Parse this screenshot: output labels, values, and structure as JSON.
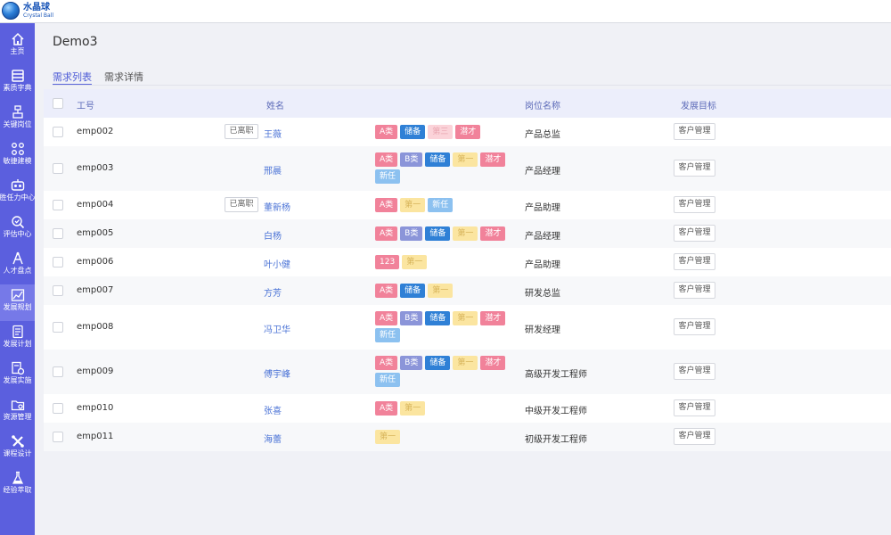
{
  "app": {
    "logo_cn": "水晶球",
    "logo_en": "Crystal Ball"
  },
  "sidebar": {
    "items": [
      {
        "label": "主页",
        "icon": "home-icon"
      },
      {
        "label": "素质字典",
        "icon": "dictionary-icon"
      },
      {
        "label": "关键岗位",
        "icon": "key-position-icon"
      },
      {
        "label": "敏捷建模",
        "icon": "modeling-icon"
      },
      {
        "label": "胜任力中心",
        "icon": "competency-icon"
      },
      {
        "label": "评估中心",
        "icon": "assessment-icon"
      },
      {
        "label": "人才盘点",
        "icon": "talent-review-icon"
      },
      {
        "label": "发展规划",
        "icon": "development-plan-icon",
        "active": true
      },
      {
        "label": "发展计划",
        "icon": "development-schedule-icon"
      },
      {
        "label": "发展实施",
        "icon": "development-implement-icon"
      },
      {
        "label": "资源管理",
        "icon": "resource-folder-icon"
      },
      {
        "label": "课程设计",
        "icon": "course-design-icon"
      },
      {
        "label": "经验萃取",
        "icon": "experience-flask-icon"
      }
    ]
  },
  "page": {
    "title": "Demo3"
  },
  "tabs": [
    {
      "label": "需求列表",
      "active": true
    },
    {
      "label": "需求详情",
      "active": false
    }
  ],
  "table": {
    "headers": {
      "id": "工号",
      "name": "姓名",
      "position": "岗位名称",
      "goal": "发展目标"
    },
    "rows": [
      {
        "id": "emp002",
        "name": "王薇",
        "status": "已离职",
        "tags": [
          {
            "text": "A类",
            "cls": "t-a"
          },
          {
            "text": "储备",
            "cls": "t-cb"
          },
          {
            "text": "第三",
            "cls": "t-d3"
          },
          {
            "text": "潜才",
            "cls": "t-qc"
          }
        ],
        "position": "产品总监",
        "goal": "客户管理"
      },
      {
        "id": "emp003",
        "name": "邢晨",
        "status": "",
        "tags": [
          {
            "text": "A类",
            "cls": "t-a"
          },
          {
            "text": "B类",
            "cls": "t-b"
          },
          {
            "text": "储备",
            "cls": "t-cb"
          },
          {
            "text": "第一",
            "cls": "t-d1"
          },
          {
            "text": "潜才",
            "cls": "t-qc"
          },
          {
            "text": "新任",
            "cls": "t-new"
          }
        ],
        "position": "产品经理",
        "goal": "客户管理"
      },
      {
        "id": "emp004",
        "name": "董新杨",
        "status": "已离职",
        "tags": [
          {
            "text": "A类",
            "cls": "t-a"
          },
          {
            "text": "第一",
            "cls": "t-d1"
          },
          {
            "text": "新任",
            "cls": "t-new"
          }
        ],
        "position": "产品助理",
        "goal": "客户管理"
      },
      {
        "id": "emp005",
        "name": "白杨",
        "status": "",
        "tags": [
          {
            "text": "A类",
            "cls": "t-a"
          },
          {
            "text": "B类",
            "cls": "t-b"
          },
          {
            "text": "储备",
            "cls": "t-cb"
          },
          {
            "text": "第一",
            "cls": "t-d1"
          },
          {
            "text": "潜才",
            "cls": "t-qc"
          }
        ],
        "position": "产品经理",
        "goal": "客户管理"
      },
      {
        "id": "emp006",
        "name": "叶小健",
        "status": "",
        "tags": [
          {
            "text": "123",
            "cls": "t-123"
          },
          {
            "text": "第一",
            "cls": "t-d1"
          }
        ],
        "position": "产品助理",
        "goal": "客户管理"
      },
      {
        "id": "emp007",
        "name": "方芳",
        "status": "",
        "tags": [
          {
            "text": "A类",
            "cls": "t-a"
          },
          {
            "text": "储备",
            "cls": "t-cb"
          },
          {
            "text": "第一",
            "cls": "t-d1"
          }
        ],
        "position": "研发总监",
        "goal": "客户管理"
      },
      {
        "id": "emp008",
        "name": "冯卫华",
        "status": "",
        "tags": [
          {
            "text": "A类",
            "cls": "t-a"
          },
          {
            "text": "B类",
            "cls": "t-b"
          },
          {
            "text": "储备",
            "cls": "t-cb"
          },
          {
            "text": "第一",
            "cls": "t-d1"
          },
          {
            "text": "潜才",
            "cls": "t-qc"
          },
          {
            "text": "新任",
            "cls": "t-new"
          }
        ],
        "position": "研发经理",
        "goal": "客户管理"
      },
      {
        "id": "emp009",
        "name": "傅宇峰",
        "status": "",
        "tags": [
          {
            "text": "A类",
            "cls": "t-a"
          },
          {
            "text": "B类",
            "cls": "t-b"
          },
          {
            "text": "储备",
            "cls": "t-cb"
          },
          {
            "text": "第一",
            "cls": "t-d1"
          },
          {
            "text": "潜才",
            "cls": "t-qc"
          },
          {
            "text": "新任",
            "cls": "t-new"
          }
        ],
        "position": "高级开发工程师",
        "goal": "客户管理"
      },
      {
        "id": "emp010",
        "name": "张喜",
        "status": "",
        "tags": [
          {
            "text": "A类",
            "cls": "t-a"
          },
          {
            "text": "第一",
            "cls": "t-d1"
          }
        ],
        "position": "中级开发工程师",
        "goal": "客户管理"
      },
      {
        "id": "emp011",
        "name": "海蕾",
        "status": "",
        "tags": [
          {
            "text": "第一",
            "cls": "t-d1"
          }
        ],
        "position": "初级开发工程师",
        "goal": "客户管理"
      }
    ]
  },
  "colors": {
    "sidebar": "#5b5fde",
    "accent": "#4d5bd6",
    "tag_a": "#f1829a",
    "tag_b": "#8b95d9",
    "tag_reserve": "#2f80d6",
    "tag_first": "#fbe5a0",
    "tag_new": "#8cc1f0"
  }
}
